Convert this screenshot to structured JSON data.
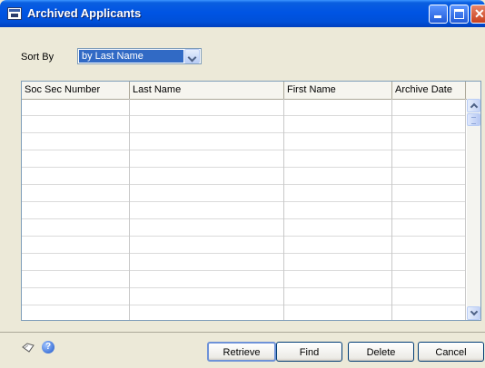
{
  "window": {
    "title": "Archived Applicants"
  },
  "sort": {
    "label": "Sort By",
    "value": "by Last Name"
  },
  "grid": {
    "columns": [
      "Soc Sec Number",
      "Last Name",
      "First Name",
      "Archive Date"
    ],
    "rows": []
  },
  "buttons": {
    "retrieve": "Retrieve",
    "find": "Find",
    "delete": "Delete",
    "cancel": "Cancel"
  },
  "icons": {
    "note": "note-icon",
    "help": "help-icon"
  }
}
